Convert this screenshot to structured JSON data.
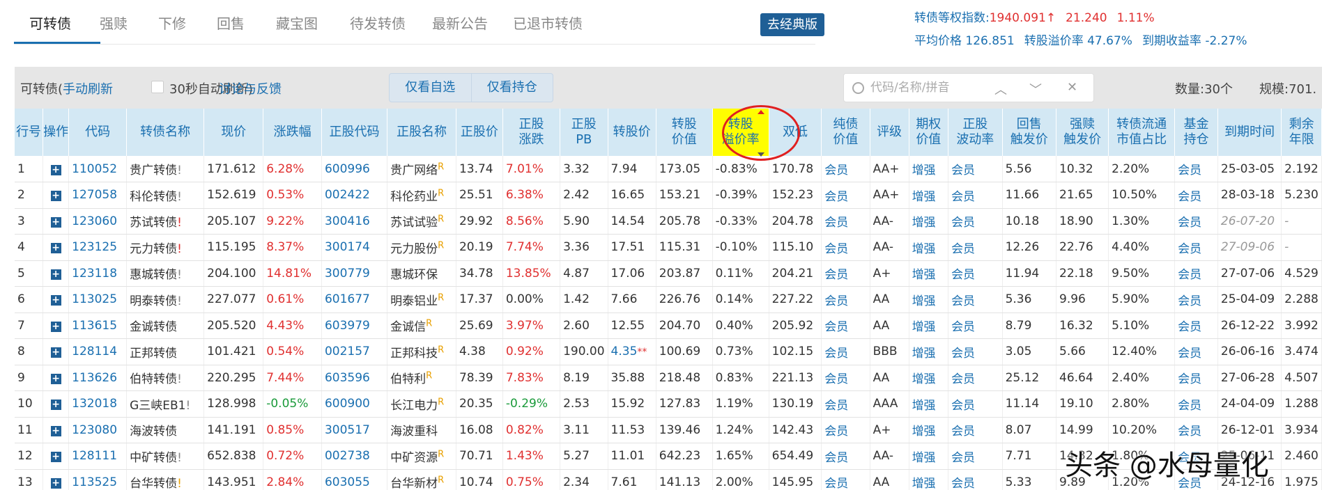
{
  "nav": {
    "tabs": [
      "可转债",
      "强赎",
      "下修",
      "回售",
      "藏宝图",
      "待发转债",
      "最新公告",
      "已退市转债"
    ],
    "classic_button": "去经典版"
  },
  "index_info": {
    "label": "转债等权指数:",
    "value": "1940.091",
    "arrow": "↑",
    "change": "21.240",
    "change_pct": "1.11%",
    "avg_price": "平均价格 126.851",
    "premium": "转股溢价率 47.67%",
    "ytm": "到期收益率 -2.27%"
  },
  "toolbar": {
    "title": "可转债(",
    "manual_refresh": "手动刷新",
    "auto_refresh": "30秒自动刷新)",
    "discussion": "讨论与反馈",
    "only_watchlist": "仅看自选",
    "only_holdings": "仅看持仓",
    "search_placeholder": "代码/名称/拼音",
    "count": "数量:30个",
    "scale": "规模:701."
  },
  "columns": [
    "行号",
    "操作",
    "代码",
    "转债名称",
    "现价",
    "涨跌幅",
    "正股代码",
    "正股名称",
    "正股价",
    "正股\n涨跌",
    "正股\nPB",
    "转股价",
    "转股\n价值",
    "转股\n溢价率",
    "双低",
    "纯债\n价值",
    "评级",
    "期权\n价值",
    "正股\n波动率",
    "回售\n触发价",
    "强赎\n触发价",
    "转债流通\n市值占比",
    "基金\n持仓",
    "到期时间",
    "剩余\n年限"
  ],
  "rows": [
    [
      "1",
      "110052",
      "贵广转债",
      "!",
      "gray",
      "171.612",
      "6.28%",
      "600996",
      "贵广网络",
      "R",
      "13.74",
      "7.01%",
      "3.32",
      "7.94",
      "",
      "173.05",
      "-0.83%",
      "170.78",
      "会员",
      "AA+",
      "增强",
      "会员",
      "5.56",
      "10.32",
      "2.20%",
      "会员",
      "25-03-05",
      "2.192"
    ],
    [
      "2",
      "127058",
      "科伦转债",
      "!",
      "gray",
      "152.619",
      "0.53%",
      "002422",
      "科伦药业",
      "R",
      "25.51",
      "6.38%",
      "2.42",
      "16.65",
      "",
      "153.21",
      "-0.39%",
      "152.23",
      "会员",
      "AA+",
      "增强",
      "会员",
      "11.66",
      "21.65",
      "10.50%",
      "会员",
      "28-03-18",
      "5.230"
    ],
    [
      "3",
      "123060",
      "苏试转债",
      "!",
      "red",
      "205.107",
      "9.22%",
      "300416",
      "苏试试验",
      "R",
      "29.92",
      "8.56%",
      "5.90",
      "14.54",
      "",
      "205.78",
      "-0.33%",
      "204.78",
      "会员",
      "AA-",
      "增强",
      "会员",
      "10.18",
      "18.90",
      "1.30%",
      "会员",
      "26-07-20",
      "-"
    ],
    [
      "4",
      "123125",
      "元力转债",
      "!",
      "red",
      "115.195",
      "8.37%",
      "300174",
      "元力股份",
      "R",
      "20.19",
      "7.74%",
      "3.36",
      "17.51",
      "",
      "115.31",
      "-0.10%",
      "115.10",
      "会员",
      "AA-",
      "增强",
      "会员",
      "12.26",
      "22.76",
      "4.40%",
      "会员",
      "27-09-06",
      "-"
    ],
    [
      "5",
      "123118",
      "惠城转债",
      "!",
      "gray",
      "204.100",
      "14.81%",
      "300779",
      "惠城环保",
      "",
      "34.78",
      "13.85%",
      "4.87",
      "17.06",
      "",
      "203.87",
      "0.11%",
      "204.21",
      "会员",
      "A+",
      "增强",
      "会员",
      "11.94",
      "22.18",
      "9.50%",
      "会员",
      "27-07-06",
      "4.529"
    ],
    [
      "6",
      "113025",
      "明泰转债",
      "!",
      "gray",
      "227.077",
      "0.61%",
      "601677",
      "明泰铝业",
      "R",
      "17.37",
      "0.00%",
      "1.42",
      "7.66",
      "",
      "226.76",
      "0.14%",
      "227.22",
      "会员",
      "AA",
      "增强",
      "会员",
      "5.36",
      "9.96",
      "5.90%",
      "会员",
      "25-04-09",
      "2.288"
    ],
    [
      "7",
      "113615",
      "金诚转债",
      "",
      "",
      "205.520",
      "4.43%",
      "603979",
      "金诚信",
      "R",
      "25.69",
      "3.97%",
      "2.60",
      "12.55",
      "",
      "204.70",
      "0.40%",
      "205.92",
      "会员",
      "AA",
      "增强",
      "会员",
      "8.79",
      "16.32",
      "5.10%",
      "会员",
      "26-12-22",
      "3.992"
    ],
    [
      "8",
      "128114",
      "正邦转债",
      "",
      "",
      "101.421",
      "0.54%",
      "002157",
      "正邦科技",
      "R",
      "4.38",
      "0.92%",
      "190.00",
      "4.35",
      "**",
      "100.69",
      "0.73%",
      "102.15",
      "会员",
      "BBB",
      "增强",
      "会员",
      "3.05",
      "5.66",
      "12.40%",
      "会员",
      "26-06-16",
      "3.474"
    ],
    [
      "9",
      "113626",
      "伯特转债",
      "!",
      "gray",
      "220.295",
      "7.44%",
      "603596",
      "伯特利",
      "R",
      "78.39",
      "7.83%",
      "8.19",
      "35.88",
      "",
      "218.48",
      "0.83%",
      "221.13",
      "会员",
      "AA",
      "增强",
      "会员",
      "25.12",
      "46.64",
      "2.40%",
      "会员",
      "27-06-28",
      "4.507"
    ],
    [
      "10",
      "132018",
      "G三峡EB1",
      "!",
      "gray",
      "128.998",
      "-0.05%",
      "600900",
      "长江电力",
      "R",
      "20.35",
      "-0.29%",
      "2.53",
      "15.92",
      "",
      "127.83",
      "1.19%",
      "130.19",
      "会员",
      "AAA",
      "增强",
      "会员",
      "11.14",
      "19.10",
      "2.80%",
      "会员",
      "24-04-09",
      "1.288"
    ],
    [
      "11",
      "123080",
      "海波转债",
      "",
      "",
      "141.191",
      "0.85%",
      "300517",
      "海波重科",
      "",
      "16.08",
      "0.82%",
      "3.11",
      "11.53",
      "",
      "139.46",
      "1.24%",
      "142.43",
      "会员",
      "A+",
      "增强",
      "会员",
      "8.07",
      "14.99",
      "10.20%",
      "会员",
      "26-12-01",
      "3.934"
    ],
    [
      "12",
      "128111",
      "中矿转债",
      "!",
      "gray",
      "652.838",
      "0.72%",
      "002738",
      "中矿资源",
      "R",
      "70.71",
      "1.43%",
      "5.27",
      "11.01",
      "",
      "642.23",
      "1.65%",
      "654.49",
      "会员",
      "AA-",
      "增强",
      "会员",
      "7.71",
      "14.32",
      "1.80%",
      "会员",
      "25-06-11",
      "2.460"
    ],
    [
      "13",
      "113525",
      "台华转债",
      "!",
      "amber",
      "143.951",
      "2.84%",
      "603055",
      "台华新材",
      "R",
      "10.74",
      "0.75%",
      "2.34",
      "7.61",
      "",
      "141.13",
      "2.00%",
      "145.95",
      "会员",
      "AA",
      "增强",
      "会员",
      "5.33",
      "9.89",
      "1.20%",
      "会员",
      "24-12-16",
      "1.975"
    ]
  ],
  "watermark": "头条 @水母量化"
}
